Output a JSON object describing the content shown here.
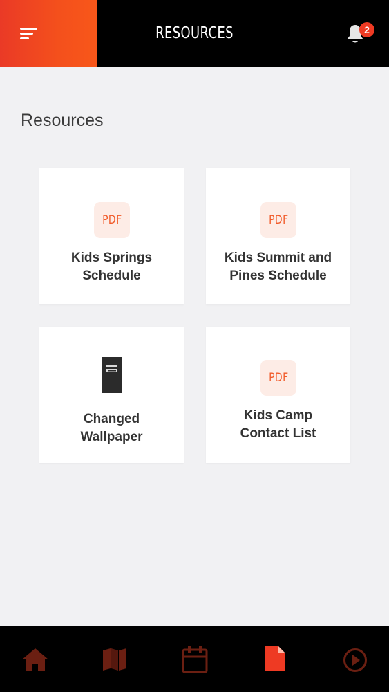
{
  "header": {
    "title": "RESOURCES",
    "notification_count": "2",
    "icons": {
      "menu": "hamburger-menu-icon",
      "bell": "bell-icon"
    }
  },
  "page": {
    "heading": "Resources"
  },
  "resources": [
    {
      "type": "pdf",
      "icon_label": "PDF",
      "line1": "Kids Springs",
      "line2": "Schedule"
    },
    {
      "type": "pdf",
      "icon_label": "PDF",
      "line1": "Kids Summit and",
      "line2": "Pines Schedule"
    },
    {
      "type": "archive",
      "icon": "archive-box-icon",
      "line1": "Changed",
      "line2": "Wallpaper"
    },
    {
      "type": "pdf",
      "icon_label": "PDF",
      "line1": "Kids Camp",
      "line2": "Contact List"
    }
  ],
  "bottom_nav": {
    "tabs": [
      {
        "icon": "home-icon",
        "active": false
      },
      {
        "icon": "map-icon",
        "active": false
      },
      {
        "icon": "calendar-icon",
        "active": false
      },
      {
        "icon": "document-icon",
        "active": true
      },
      {
        "icon": "play-icon",
        "active": false
      }
    ]
  },
  "colors": {
    "accent": "#f15a29",
    "accent_red": "#ee3a23",
    "inactive_tab": "#6b1f12",
    "background": "#f1f1f3",
    "bar": "#000000"
  }
}
